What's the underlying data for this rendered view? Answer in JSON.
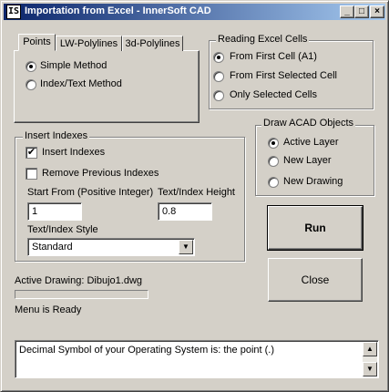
{
  "window": {
    "title": "Importation from Excel - InnerSoft CAD",
    "icon": "IS",
    "controls": {
      "minimize": "_",
      "maximize": "□",
      "close": "×"
    }
  },
  "tabs": [
    {
      "label": "Points",
      "active": true
    },
    {
      "label": "LW-Polylines",
      "active": false
    },
    {
      "label": "3d-Polylines",
      "active": false
    }
  ],
  "points_tab": {
    "options": [
      {
        "label": "Simple Method",
        "selected": true
      },
      {
        "label": "Index/Text Method",
        "selected": false
      }
    ]
  },
  "reading_cells": {
    "title": "Reading Excel Cells",
    "options": [
      {
        "label": "From First Cell (A1)",
        "selected": true
      },
      {
        "label": "From First Selected Cell",
        "selected": false
      },
      {
        "label": "Only Selected Cells",
        "selected": false
      }
    ]
  },
  "insert_indexes": {
    "title": "Insert Indexes",
    "insert_label": "Insert Indexes",
    "insert_checked": true,
    "remove_label": "Remove Previous Indexes",
    "remove_checked": false,
    "start_label": "Start From (Positive Integer)",
    "start_value": "1",
    "height_label": "Text/Index Height",
    "height_value": "0.8",
    "style_label": "Text/Index Style",
    "style_value": "Standard"
  },
  "draw_objects": {
    "title": "Draw ACAD Objects",
    "options": [
      {
        "label": "Active Layer",
        "selected": true
      },
      {
        "label": "New Layer",
        "selected": false
      },
      {
        "label": "New Drawing",
        "selected": false
      }
    ]
  },
  "buttons": {
    "run": "Run",
    "close": "Close"
  },
  "status": {
    "active_drawing": "Active Drawing: Dibujo1.dwg",
    "progress": 0,
    "menu": "Menu is Ready"
  },
  "message": "Decimal Symbol of your Operating System is: the point (.)",
  "icons": {
    "scroll_up": "▲",
    "scroll_down": "▼",
    "dropdown": "▼",
    "check": "✔"
  }
}
